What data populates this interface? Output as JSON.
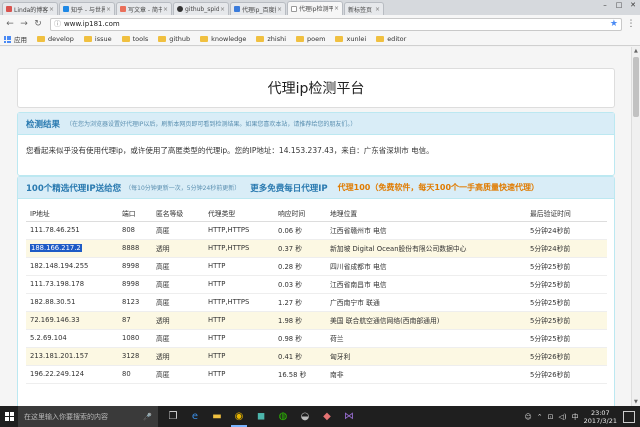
{
  "browser": {
    "tabs": [
      {
        "label": "Linda的博客",
        "color": "#d9534f",
        "active": false
      },
      {
        "label": "知乎 - 与世界分享",
        "color": "#1e88e5",
        "active": false
      },
      {
        "label": "写文章 - 简书",
        "color": "#ea6f5a",
        "active": false
      },
      {
        "label": "github_spider",
        "color": "#333333",
        "active": false
      },
      {
        "label": "代理ip_百度搜索",
        "color": "#3b7cdb",
        "active": false
      },
      {
        "label": "代理ip检测平台",
        "color": "#888888",
        "active": true
      },
      {
        "label": "新标签页",
        "color": "#cccccc",
        "active": false
      }
    ],
    "close_glyph": "×",
    "url": "www.ip181.com",
    "bookmarks": [
      "应用",
      "develop",
      "issue",
      "tools",
      "github",
      "knowledge",
      "zhishi",
      "poem",
      "xunlei",
      "editor"
    ]
  },
  "page": {
    "title": "代理ip检测平台",
    "detect": {
      "heading": "检测结果",
      "hint": "（在您为浏览器设置好代理IP以后，刷新本网页即可看到检测结果。如果您喜欢本站，请推荐给您的朋友们。）",
      "result": "您看起来似乎没有使用代理ip，或许使用了高匿类型的代理ip。您的IP地址：14.153.237.43，来自：广东省深圳市 电信。"
    },
    "list": {
      "heading": "100个精选代理IP送给您",
      "subheading": "（每10分钟更新一次，5分钟24秒前更新）",
      "link": "更多免费每日代理IP",
      "promo": "代理100（免费软件，每天100个一手高质量快速代理）",
      "columns": [
        "IP地址",
        "端口",
        "匿名等级",
        "代理类型",
        "响应时间",
        "地理位置",
        "最后验证时间"
      ],
      "rows": [
        [
          "111.78.46.251",
          "808",
          "高匿",
          "HTTP,HTTPS",
          "0.06 秒",
          "江西省赣州市 电信",
          "5分钟24秒前"
        ],
        [
          "188.166.217.2",
          "8888",
          "透明",
          "HTTP,HTTPS",
          "0.37 秒",
          "新加坡 Digital Ocean股份有限公司数据中心",
          "5分钟24秒前"
        ],
        [
          "182.148.194.255",
          "8998",
          "高匿",
          "HTTP",
          "0.28 秒",
          "四川省成都市 电信",
          "5分钟25秒前"
        ],
        [
          "111.73.198.178",
          "8998",
          "高匿",
          "HTTP",
          "0.03 秒",
          "江西省南昌市 电信",
          "5分钟25秒前"
        ],
        [
          "182.88.30.51",
          "8123",
          "高匿",
          "HTTP,HTTPS",
          "1.27 秒",
          "广西南宁市 联通",
          "5分钟25秒前"
        ],
        [
          "72.169.146.33",
          "87",
          "透明",
          "HTTP",
          "1.98 秒",
          "美国 联合航空通信网络(西南部通用)",
          "5分钟25秒前"
        ],
        [
          "5.2.69.104",
          "1080",
          "高匿",
          "HTTP",
          "0.98 秒",
          "荷兰",
          "5分钟25秒前"
        ],
        [
          "213.181.201.157",
          "3128",
          "透明",
          "HTTP",
          "0.41 秒",
          "匈牙利",
          "5分钟26秒前"
        ],
        [
          "196.22.249.124",
          "80",
          "高匿",
          "HTTP",
          "16.58 秒",
          "南非",
          "5分钟26秒前"
        ]
      ]
    }
  },
  "taskbar": {
    "search_placeholder": "在这里输入你要搜索的内容",
    "time": "23:07",
    "date": "2017/3/21",
    "input_method": "中"
  },
  "colors": {
    "panel_head_bg": "#d9edf7",
    "heading_blue": "#2a7ab0",
    "promo_orange": "#e07b00",
    "stripe": "#fcf8e3",
    "selection": "#1e5bc6"
  }
}
